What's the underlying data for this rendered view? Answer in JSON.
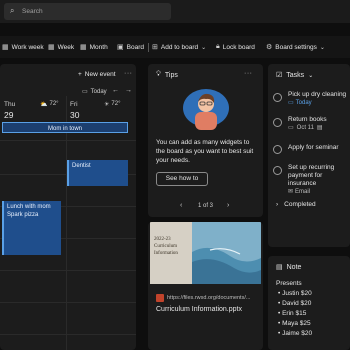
{
  "search": {
    "placeholder": "Search"
  },
  "toolbar": {
    "work_week": "Work week",
    "week": "Week",
    "month": "Month",
    "board": "Board",
    "add_to_board": "Add to board",
    "lock_board": "Lock board",
    "board_settings": "Board settings"
  },
  "calendar": {
    "new_event": "New event",
    "today": "Today",
    "days": [
      {
        "name": "Thu",
        "num": "29",
        "temp": "72°"
      },
      {
        "name": "Fri",
        "num": "30",
        "temp": "72°"
      }
    ],
    "all_day_event": "Mom in town",
    "events": [
      "Dentist",
      "Lunch with mom",
      "Spark pizza"
    ]
  },
  "tips": {
    "title": "Tips",
    "body": "You can add as many widgets to the board as you want to best suit your needs.",
    "button": "See how to",
    "pager": "1 of 3"
  },
  "document": {
    "thumb_title": "2022-23 Curriculum Information",
    "url": "https://files.rwsd.org/documents/...",
    "filename": "Curriculum Information.pptx"
  },
  "tasks": {
    "title": "Tasks",
    "items": [
      {
        "label": "Pick up dry cleaning",
        "sub": "Today"
      },
      {
        "label": "Return books",
        "sub": "Oct 11"
      },
      {
        "label": "Apply for seminar",
        "sub": ""
      },
      {
        "label": "Set up recurring payment for insurance",
        "sub": "Email"
      }
    ],
    "completed": "Completed"
  },
  "note": {
    "title": "Note",
    "heading": "Presents",
    "lines": [
      "Justin $20",
      "David $20",
      "Erin $15",
      "Maya $25",
      "Jaime $20"
    ]
  },
  "colors": {
    "accent": "#1f4e8c",
    "accent_light": "#5aa0e6"
  }
}
